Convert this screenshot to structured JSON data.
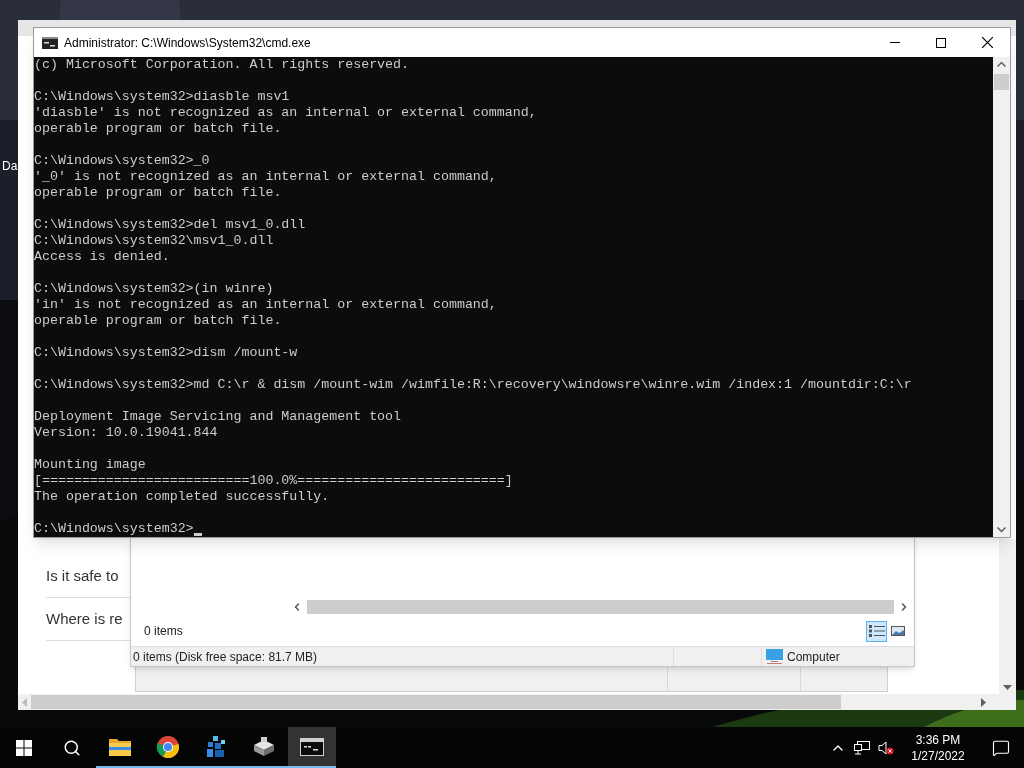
{
  "desktop": {
    "icon_label": "Da"
  },
  "browser": {
    "items": [
      "Is it safe to",
      "Where is re"
    ]
  },
  "explorer": {
    "item_count": "0 items",
    "status_text": "0 items (Disk free space: 81.7 MB)",
    "location": "Computer",
    "views": [
      {
        "kind": "details",
        "selected": true
      },
      {
        "kind": "preview",
        "selected": false
      }
    ]
  },
  "cmd": {
    "title": "Administrator: C:\\Windows\\System32\\cmd.exe",
    "blocks": [
      [
        "(c) Microsoft Corporation. All rights reserved."
      ],
      [
        "C:\\Windows\\system32>diasble msv1",
        "'diasble' is not recognized as an internal or external command,",
        "operable program or batch file."
      ],
      [
        "C:\\Windows\\system32>_0",
        "'_0' is not recognized as an internal or external command,",
        "operable program or batch file."
      ],
      [
        "C:\\Windows\\system32>del msv1_0.dll",
        "C:\\Windows\\system32\\msv1_0.dll",
        "Access is denied."
      ],
      [
        "C:\\Windows\\system32>(in winre)",
        "'in' is not recognized as an internal or external command,",
        "operable program or batch file."
      ],
      [
        "C:\\Windows\\system32>dism /mount-w"
      ],
      [
        "C:\\Windows\\system32>md C:\\r & dism /mount-wim /wimfile:R:\\recovery\\windowsre\\winre.wim /index:1 /mountdir:C:\\r"
      ],
      [
        "Deployment Image Servicing and Management tool",
        "Version: 10.0.19041.844"
      ],
      [
        "Mounting image",
        "[==========================100.0%==========================]",
        "The operation completed successfully."
      ]
    ],
    "prompt": "C:\\Windows\\system32>"
  },
  "taskbar": {
    "apps": [
      {
        "kind": "folder",
        "active": false
      },
      {
        "kind": "browser",
        "active": false
      },
      {
        "kind": "blocks",
        "active": false
      },
      {
        "kind": "drive",
        "active": false
      },
      {
        "kind": "console",
        "active": true
      }
    ],
    "clock": {
      "time": "3:36 PM",
      "date": "1/27/2022"
    }
  }
}
